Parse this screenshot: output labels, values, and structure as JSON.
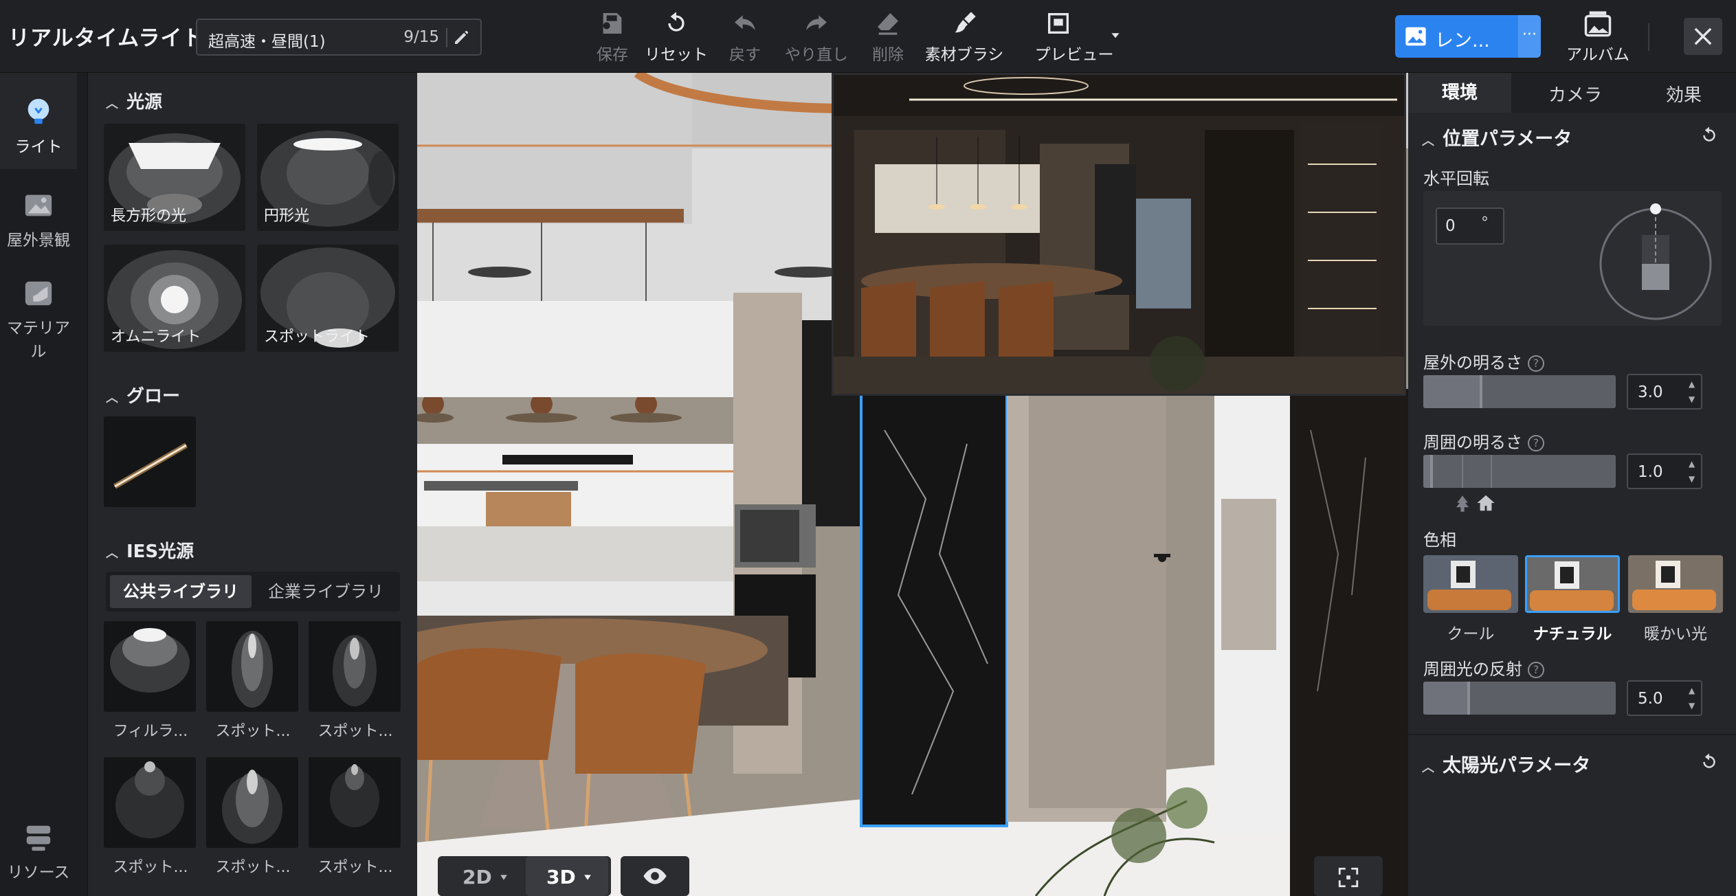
{
  "app": {
    "title": "リアルタイムライト"
  },
  "scene": {
    "name": "超高速・昼間(1)",
    "count": "9/15"
  },
  "toolbar": {
    "save": "保存",
    "reset": "リセット",
    "undo": "戻す",
    "redo": "やり直し",
    "delete": "削除",
    "material_brush": "素材ブラシ",
    "preview": "プレビュー",
    "render": "レン...",
    "render_more": "···",
    "album": "アルバム"
  },
  "rail": {
    "items": [
      {
        "label": "ライト"
      },
      {
        "label": "屋外景観"
      },
      {
        "label": "マテリアル"
      },
      {
        "label": "リソース"
      }
    ]
  },
  "light_panel": {
    "sources_title": "光源",
    "sources": [
      {
        "label": "長方形の光"
      },
      {
        "label": "円形光"
      },
      {
        "label": "オムニライト"
      },
      {
        "label": "スポットライト"
      }
    ],
    "glow_title": "グロー",
    "ies_title": "IES光源",
    "tabs": [
      "公共ライブラリ",
      "企業ライブラリ"
    ],
    "ies_items": [
      {
        "label": "フィルラ..."
      },
      {
        "label": "スポット..."
      },
      {
        "label": "スポット..."
      },
      {
        "label": "スポット..."
      },
      {
        "label": "スポット..."
      },
      {
        "label": "スポット..."
      }
    ]
  },
  "viewport": {
    "mode_2d": "2D",
    "mode_3d": "3D"
  },
  "right_panel": {
    "tabs": [
      "環境",
      "カメラ",
      "効果"
    ],
    "position_title": "位置パラメータ",
    "rotation_label": "水平回転",
    "rotation_value": "0",
    "rotation_unit": "°",
    "outdoor_brightness_label": "屋外の明るさ",
    "outdoor_brightness_value": "3.0",
    "ambient_brightness_label": "周囲の明るさ",
    "ambient_brightness_value": "1.0",
    "hue_label": "色相",
    "hues": [
      "クール",
      "ナチュラル",
      "暖かい光"
    ],
    "hue_selected": "ナチュラル",
    "ambient_reflection_label": "周囲光の反射",
    "ambient_reflection_value": "5.0",
    "sun_title": "太陽光パラメータ",
    "help": "?"
  },
  "colors": {
    "accent": "#2b83f0",
    "selection": "#3aa0ff"
  }
}
